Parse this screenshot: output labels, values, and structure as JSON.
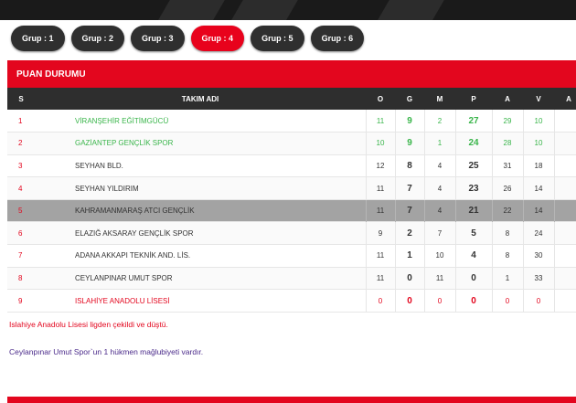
{
  "tabs": [
    {
      "label": "Grup : 1",
      "active": false
    },
    {
      "label": "Grup : 2",
      "active": false
    },
    {
      "label": "Grup : 3",
      "active": false
    },
    {
      "label": "Grup : 4",
      "active": true
    },
    {
      "label": "Grup : 5",
      "active": false
    },
    {
      "label": "Grup : 6",
      "active": false
    }
  ],
  "standings": {
    "title": "PUAN DURUMU",
    "columns": [
      "S",
      "TAKIM ADI",
      "O",
      "G",
      "M",
      "P",
      "A",
      "V",
      "A"
    ],
    "rows": [
      {
        "pos": "1",
        "team": "VİRANŞEHİR EĞİTİMGÜCÜ",
        "o": "11",
        "g": "9",
        "m": "2",
        "p": "27",
        "a": "29",
        "v": "10"
      },
      {
        "pos": "2",
        "team": "GAZİANTEP GENÇLİK SPOR",
        "o": "10",
        "g": "9",
        "m": "1",
        "p": "24",
        "a": "28",
        "v": "10"
      },
      {
        "pos": "3",
        "team": "SEYHAN BLD.",
        "o": "12",
        "g": "8",
        "m": "4",
        "p": "25",
        "a": "31",
        "v": "18"
      },
      {
        "pos": "4",
        "team": "SEYHAN YILDIRIM",
        "o": "11",
        "g": "7",
        "m": "4",
        "p": "23",
        "a": "26",
        "v": "14"
      },
      {
        "pos": "5",
        "team": "KAHRAMANMARAŞ ATCI GENÇLİK",
        "o": "11",
        "g": "7",
        "m": "4",
        "p": "21",
        "a": "22",
        "v": "14"
      },
      {
        "pos": "6",
        "team": "ELAZIĞ AKSARAY GENÇLİK SPOR",
        "o": "9",
        "g": "2",
        "m": "7",
        "p": "5",
        "a": "8",
        "v": "24"
      },
      {
        "pos": "7",
        "team": "ADANA AKKAPI TEKNİK AND. LİS.",
        "o": "11",
        "g": "1",
        "m": "10",
        "p": "4",
        "a": "8",
        "v": "30"
      },
      {
        "pos": "8",
        "team": "CEYLANPINAR UMUT SPOR",
        "o": "11",
        "g": "0",
        "m": "11",
        "p": "0",
        "a": "1",
        "v": "33"
      },
      {
        "pos": "9",
        "team": "ISLAHİYE ANADOLU LİSESİ",
        "o": "0",
        "g": "0",
        "m": "0",
        "p": "0",
        "a": "0",
        "v": "0"
      }
    ]
  },
  "notes": [
    "Islahiye Anadolu Lisesi ligden çekildi ve düştü.",
    "Ceylanpınar Umut Spor`un 1 hükmen mağlubiyeti vardır."
  ],
  "colors": {
    "accent": "#e3061e",
    "promoted": "#39b54a",
    "dark": "#2e2e2e"
  }
}
